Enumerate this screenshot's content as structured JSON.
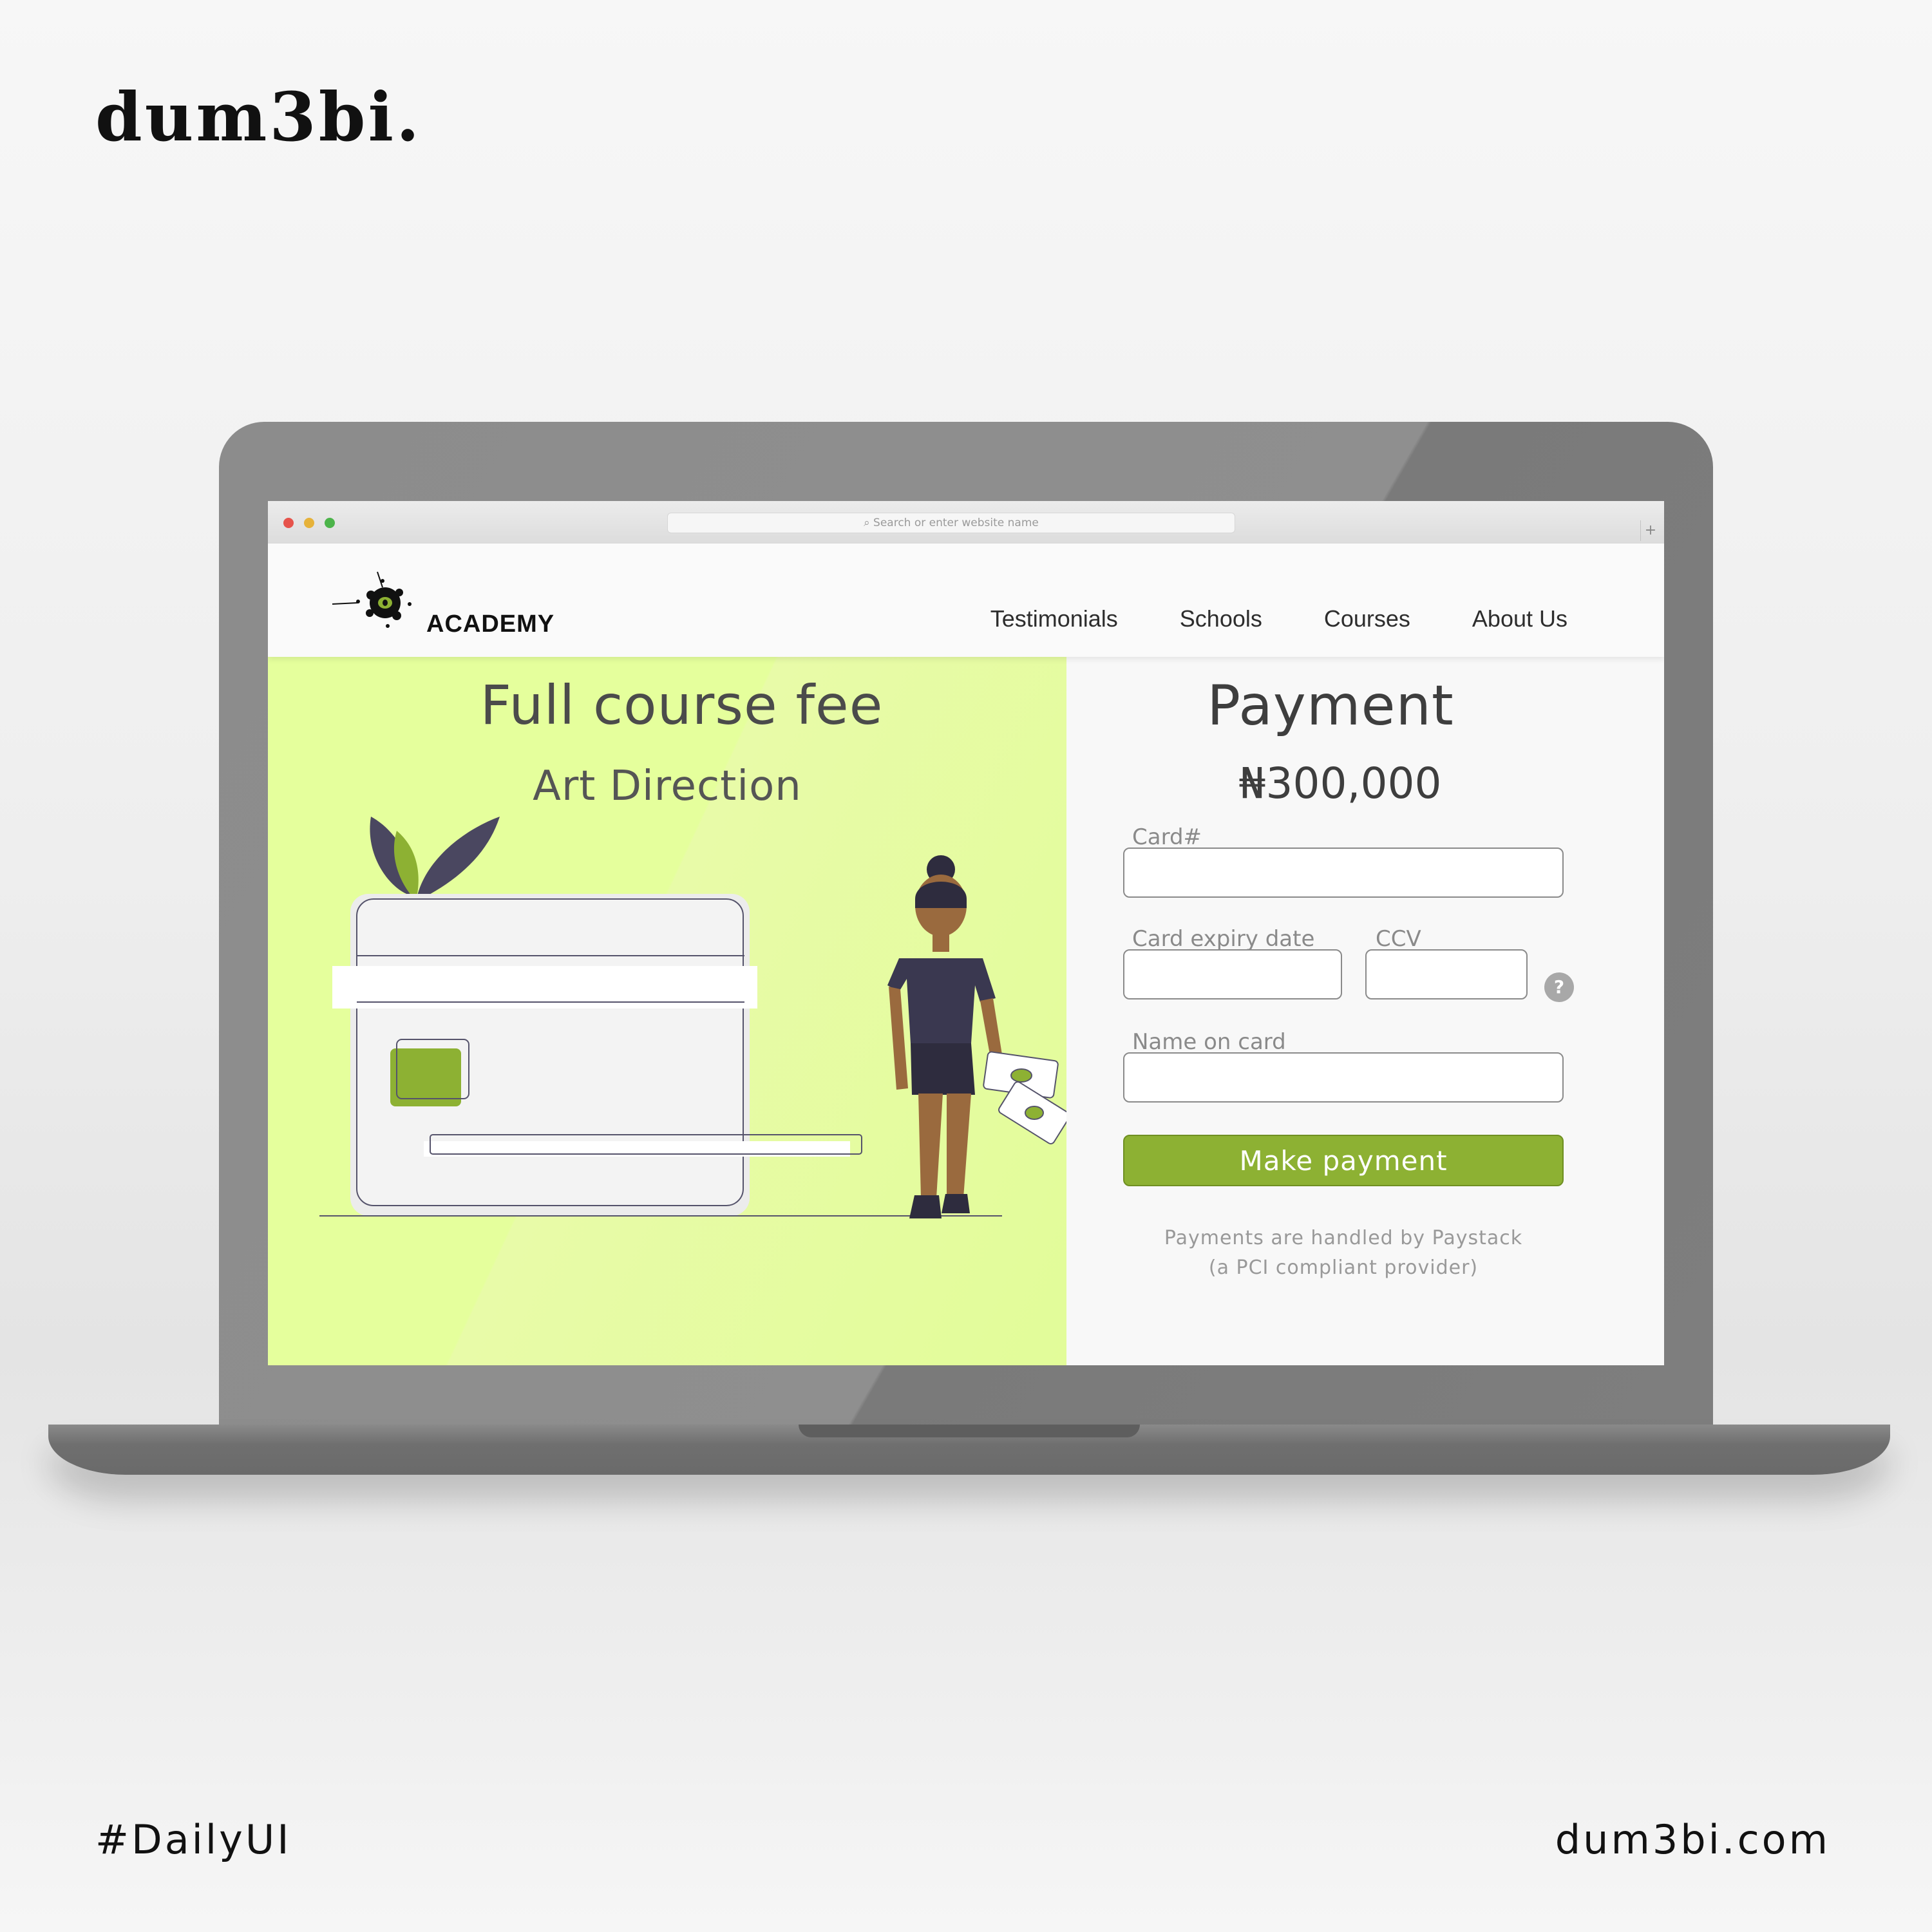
{
  "brand": {
    "logo": "dum3bi.",
    "hashtag": "#DailyUI",
    "website": "dum3bi.com"
  },
  "browser": {
    "address_placeholder": "Search or enter website name",
    "new_tab": "+"
  },
  "site": {
    "logo_text": "ACADEMY",
    "nav": [
      {
        "label": "Testimonials"
      },
      {
        "label": "Schools"
      },
      {
        "label": "Courses"
      },
      {
        "label": "About Us"
      }
    ]
  },
  "left": {
    "title": "Full course fee",
    "course": "Art Direction"
  },
  "payment": {
    "title": "Payment",
    "amount": "₦300,000",
    "card_label": "Card#",
    "expiry_label": "Card expiry date",
    "ccv_label": "CCV",
    "help": "?",
    "name_label": "Name on card",
    "button": "Make payment",
    "note_line1": "Payments are handled by Paystack",
    "note_line2": "(a PCI compliant provider)"
  },
  "colors": {
    "accent_green": "#8db133",
    "panel_lime": "#e5ff9c",
    "ink": "#3e3e3e"
  }
}
